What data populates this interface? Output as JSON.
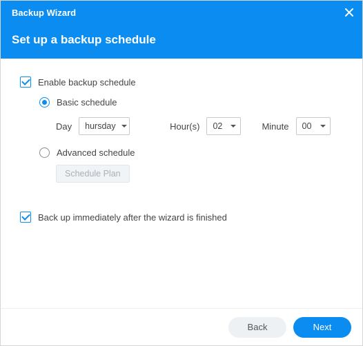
{
  "header": {
    "title": "Backup Wizard",
    "subtitle": "Set up a backup schedule"
  },
  "checkboxes": {
    "enable_label": "Enable backup schedule",
    "immediate_label": "Back up immediately after the wizard is finished"
  },
  "radios": {
    "basic_label": "Basic schedule",
    "advanced_label": "Advanced schedule"
  },
  "basic": {
    "day_label": "Day",
    "day_value": "hursday",
    "hours_label": "Hour(s)",
    "hours_value": "02",
    "minute_label": "Minute",
    "minute_value": "00"
  },
  "advanced": {
    "plan_button": "Schedule Plan"
  },
  "footer": {
    "back": "Back",
    "next": "Next"
  },
  "colors": {
    "primary": "#0a8cf0"
  }
}
